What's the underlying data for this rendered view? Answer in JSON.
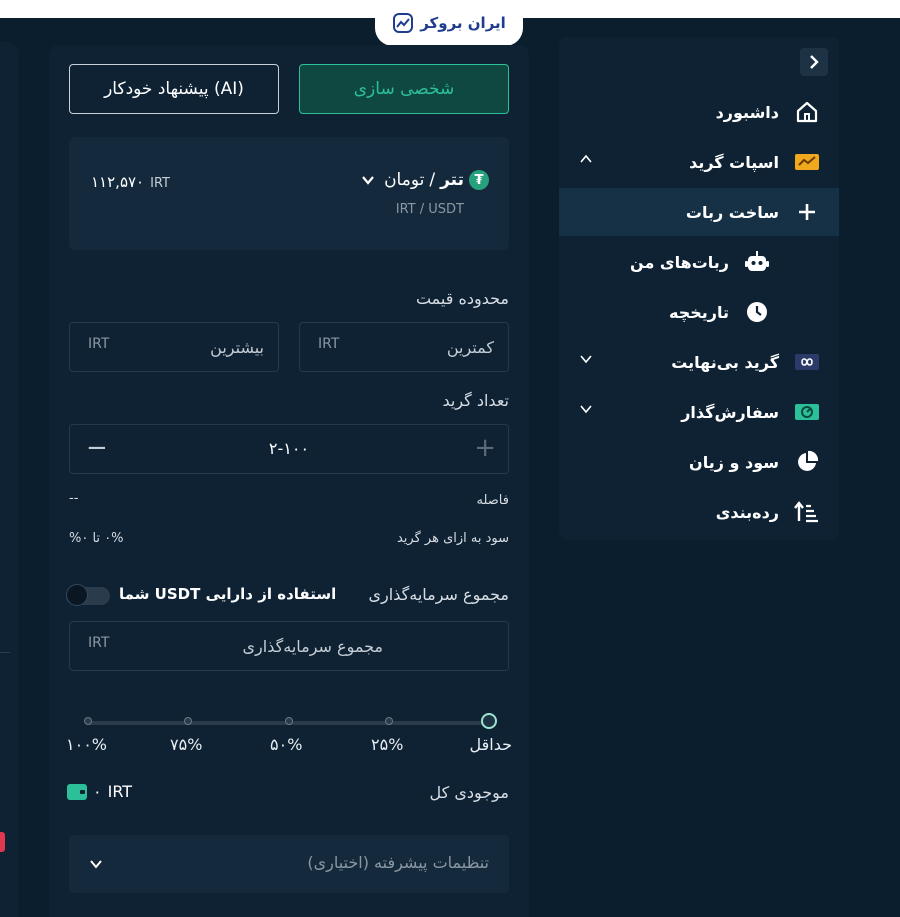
{
  "brand": {
    "name": "ایران بروکر"
  },
  "form": {
    "mode_tabs": {
      "custom": "شخصی سازی",
      "ai": "پیشنهاد خودکار (AI)"
    },
    "pair": {
      "base": "تتر",
      "quote": "تومان",
      "slash": "/",
      "sub": "IRT / USDT",
      "price": "۱۱۲,۵۷۰",
      "price_unit": "IRT",
      "icon": "tether-icon"
    },
    "price_range": {
      "label": "محدوده قیمت",
      "min_placeholder": "کمترین",
      "max_placeholder": "بیشترین",
      "unit": "IRT"
    },
    "grid_count": {
      "label": "تعداد گرید",
      "value": "۲-۱۰۰",
      "minus": "−",
      "plus": "+"
    },
    "spacing": {
      "label": "فاصله",
      "value": "--"
    },
    "profit": {
      "label": "سود به ازای هر گرید",
      "value": "۰% تا ۰%"
    },
    "investment": {
      "label": "مجموع سرمایه‌گذاری",
      "toggle_label": "استفاده از دارایی USDT شما",
      "toggle_on": false,
      "placeholder": "مجموع سرمایه‌گذاری",
      "unit": "IRT"
    },
    "slider": {
      "labels": [
        "حداقل",
        "۲۵%",
        "۵۰%",
        "۷۵%",
        "۱۰۰%"
      ],
      "value": 0
    },
    "balance": {
      "label": "موجودی کل",
      "value": "۰",
      "unit": "IRT"
    },
    "advanced": {
      "label": "تنظیمات پیشرفته (اختیاری)"
    }
  },
  "sidebar": {
    "items": [
      {
        "label": "داشبورد",
        "icon": "home-icon"
      },
      {
        "label": "اسپات گرید",
        "icon": "spot-grid-icon",
        "expanded": true
      },
      {
        "label": "ساخت ربات",
        "icon": "plus-icon",
        "active": true
      },
      {
        "label": "ربات‌های من",
        "icon": "robot-icon"
      },
      {
        "label": "تاریخچه",
        "icon": "clock-icon"
      },
      {
        "label": "گرید بی‌نهایت",
        "icon": "infinity-icon",
        "expanded": false
      },
      {
        "label": "سفارش‌گذار",
        "icon": "order-icon",
        "expanded": false
      },
      {
        "label": "سود و زیان",
        "icon": "pie-chart-icon"
      },
      {
        "label": "رده‌بندی",
        "icon": "ranking-icon"
      }
    ]
  },
  "colors": {
    "accent": "#2cc09a",
    "background": "#0b1e2e",
    "panel": "#0e2234",
    "card": "#142a3c"
  }
}
